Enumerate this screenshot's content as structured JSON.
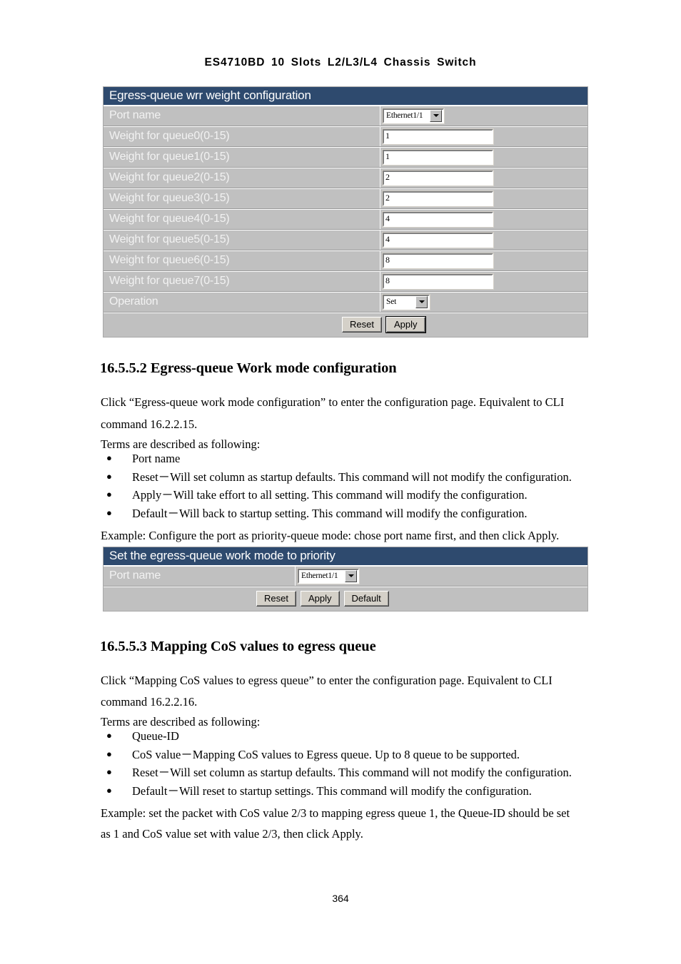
{
  "document": {
    "running_header": "ES4710BD  10  Slots  L2/L3/L4  Chassis  Switch",
    "page_number": "364"
  },
  "widget_wrr": {
    "title": "Egress-queue wrr weight configuration",
    "rows": [
      {
        "label": "Port name",
        "type": "select",
        "value": "Ethernet1/1"
      },
      {
        "label": "Weight for queue0(0-15)",
        "type": "text",
        "value": "1"
      },
      {
        "label": "Weight for queue1(0-15)",
        "type": "text",
        "value": "1"
      },
      {
        "label": "Weight for queue2(0-15)",
        "type": "text",
        "value": "2"
      },
      {
        "label": "Weight for queue3(0-15)",
        "type": "text",
        "value": "2"
      },
      {
        "label": "Weight for queue4(0-15)",
        "type": "text",
        "value": "4"
      },
      {
        "label": "Weight for queue5(0-15)",
        "type": "text",
        "value": "4"
      },
      {
        "label": "Weight for queue6(0-15)",
        "type": "text",
        "value": "8"
      },
      {
        "label": "Weight for queue7(0-15)",
        "type": "text",
        "value": "8"
      },
      {
        "label": "Operation",
        "type": "select",
        "value": "Set"
      }
    ],
    "buttons": {
      "reset": "Reset",
      "apply": "Apply"
    }
  },
  "section_2": {
    "heading": "16.5.5.2 Egress-queue Work mode configuration",
    "intro_line1": "Click “Egress-queue work mode configuration” to enter the configuration page. Equivalent to CLI",
    "intro_line2": "command 16.2.2.15.",
    "terms_lead": "Terms are described as following:",
    "bullets": [
      "Port name",
      "Reset－Will set column as startup defaults. This command will not modify the configuration.",
      "Apply－Will take effort to all setting. This command will modify the configuration.",
      "Default－Will back to startup setting. This command will modify the configuration."
    ],
    "example": "Example: Configure the port as priority-queue mode: chose port name first, and then click Apply."
  },
  "widget_workmode": {
    "title": "Set the egress-queue work mode to priority",
    "rows": [
      {
        "label": "Port name",
        "type": "select",
        "value": "Ethernet1/1"
      }
    ],
    "buttons": {
      "reset": "Reset",
      "apply": "Apply",
      "default": "Default"
    }
  },
  "section_3": {
    "heading": "16.5.5.3 Mapping CoS values to egress queue",
    "intro_line1": "Click “Mapping CoS values to egress queue” to enter the configuration page. Equivalent to CLI",
    "intro_line2": "command 16.2.2.16.",
    "terms_lead": "Terms are described as following:",
    "bullets": [
      "Queue-ID",
      "CoS value－Mapping CoS values to Egress queue. Up to 8 queue to be supported.",
      "Reset－Will set column as startup defaults. This command will not modify the configuration.",
      "Default－Will reset to startup settings. This command will modify the configuration."
    ],
    "example_line1": "Example: set the packet with CoS value 2/3 to mapping egress queue 1, the Queue-ID should be set",
    "example_line2": "as 1 and CoS value set with value 2/3, then click Apply."
  },
  "colors": {
    "widget_header_bg": "#2e4a6e",
    "widget_body_bg": "#c0c0c0",
    "button_face": "#d4d0c8"
  }
}
